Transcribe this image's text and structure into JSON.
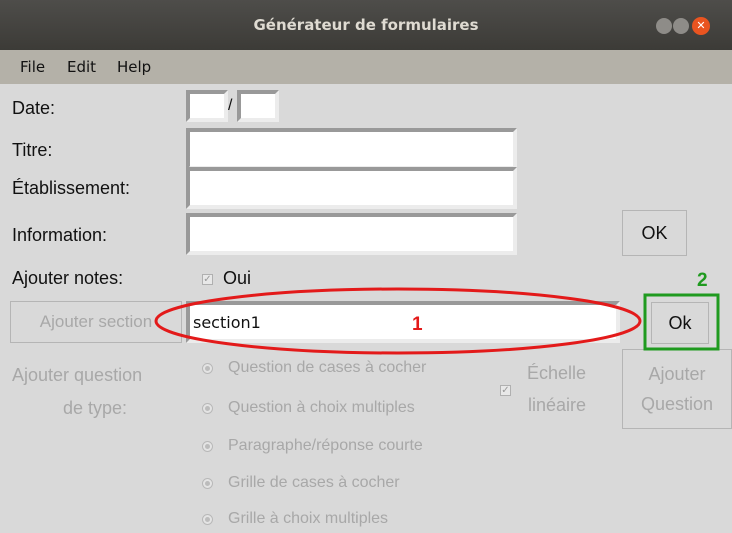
{
  "window": {
    "title": "Générateur de formulaires"
  },
  "menu": {
    "file": "File",
    "edit": "Edit",
    "help": "Help"
  },
  "form": {
    "date_label": "Date:",
    "date_separator": "/",
    "titre_label": "Titre:",
    "etablissement_label": "Établissement:",
    "information_label": "Information:",
    "ok_button": "OK",
    "notes_label": "Ajouter notes:",
    "notes_checkbox_label": "Oui",
    "notes_checked": true
  },
  "section": {
    "button": "Ajouter section",
    "value": "section1",
    "ok_button": "Ok"
  },
  "question": {
    "label_line1": "Ajouter question",
    "label_line2": "de type:",
    "types": [
      "Question de cases à cocher",
      "Question à choix multiples",
      "Paragraphe/réponse courte",
      "Grille de cases à cocher",
      "Grille à choix multiples"
    ],
    "scale_label_line1": "Échelle",
    "scale_label_line2": "linéaire",
    "add_button_line1": "Ajouter",
    "add_button_line2": "Question"
  },
  "annotations": {
    "marker1": "1",
    "marker2": "2"
  },
  "colors": {
    "annotation_red": "#e31a1a",
    "annotation_green": "#1f9a1f",
    "disabled_text": "#a8a8a8"
  }
}
